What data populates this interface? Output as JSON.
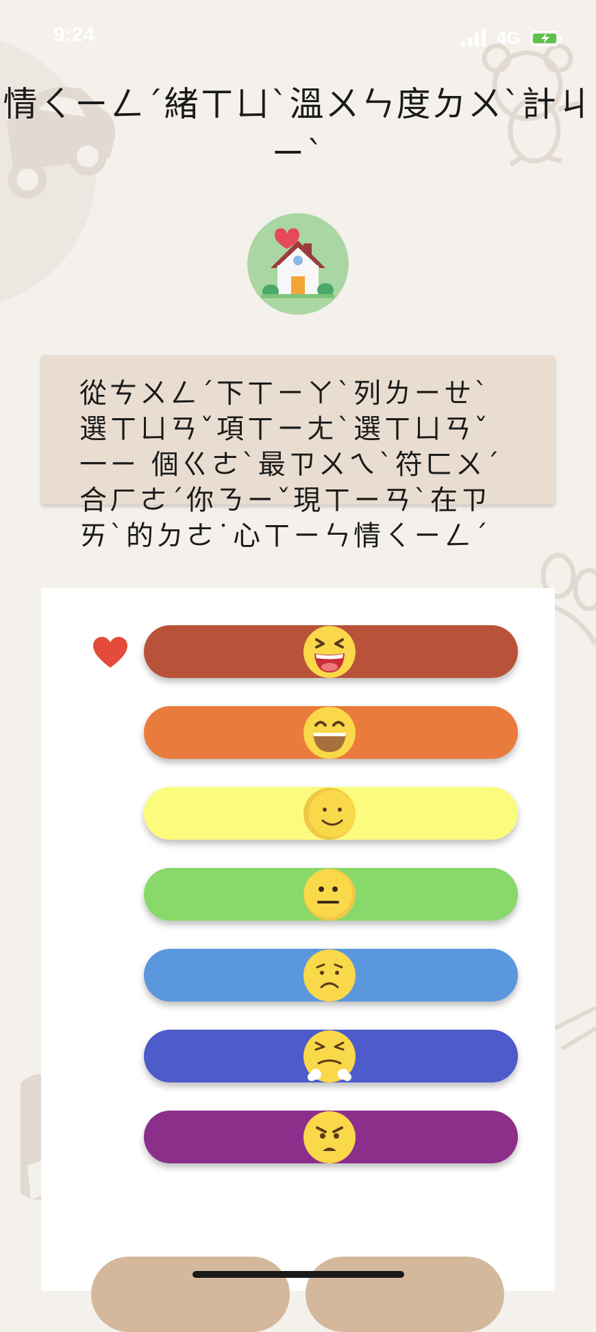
{
  "status_bar": {
    "time": "9:24",
    "network": "4G"
  },
  "header": {
    "title": "情ㄑㄧㄥˊ緒ㄒㄩˋ溫ㄨㄣ度ㄉㄨˋ計ㄐㄧˋ"
  },
  "instruction": {
    "text": "從ㄘㄨㄥˊ下ㄒㄧㄚˋ列ㄌㄧㄝˋ選ㄒㄩㄢˇ項ㄒㄧㄤˋ選ㄒㄩㄢˇ一ㄧ 個ㄍㄜˋ最ㄗㄨㄟˋ符ㄈㄨˊ合ㄏㄜˊ你ㄋㄧˇ現ㄒㄧㄢˋ在ㄗㄞˋ的ㄉㄜ˙心ㄒㄧㄣ情ㄑㄧㄥˊ"
  },
  "moods": [
    {
      "name": "laughing",
      "color": "#b8533a",
      "face": "laughing-face-icon"
    },
    {
      "name": "grinning",
      "color": "#e97b3c",
      "face": "grinning-face-icon"
    },
    {
      "name": "smiling",
      "color": "#fbfb7d",
      "face": "smiling-face-icon"
    },
    {
      "name": "neutral",
      "color": "#88d96a",
      "face": "neutral-face-icon"
    },
    {
      "name": "sad",
      "color": "#5b97dc",
      "face": "frowning-face-icon"
    },
    {
      "name": "frustrated",
      "color": "#4d5bcb",
      "face": "huffing-face-icon"
    },
    {
      "name": "angry",
      "color": "#8b2f8b",
      "face": "angry-face-icon"
    }
  ],
  "selected_mood_index": 0,
  "selected_marker": {
    "icon": "heart-icon",
    "color": "#e44b3a"
  },
  "accent_colors": {
    "background": "#f4f0ec",
    "card": "#e8ddd0",
    "button": "#d3b89c",
    "logo_circle": "#a9d6a2"
  },
  "bottom_buttons": [
    "",
    ""
  ]
}
